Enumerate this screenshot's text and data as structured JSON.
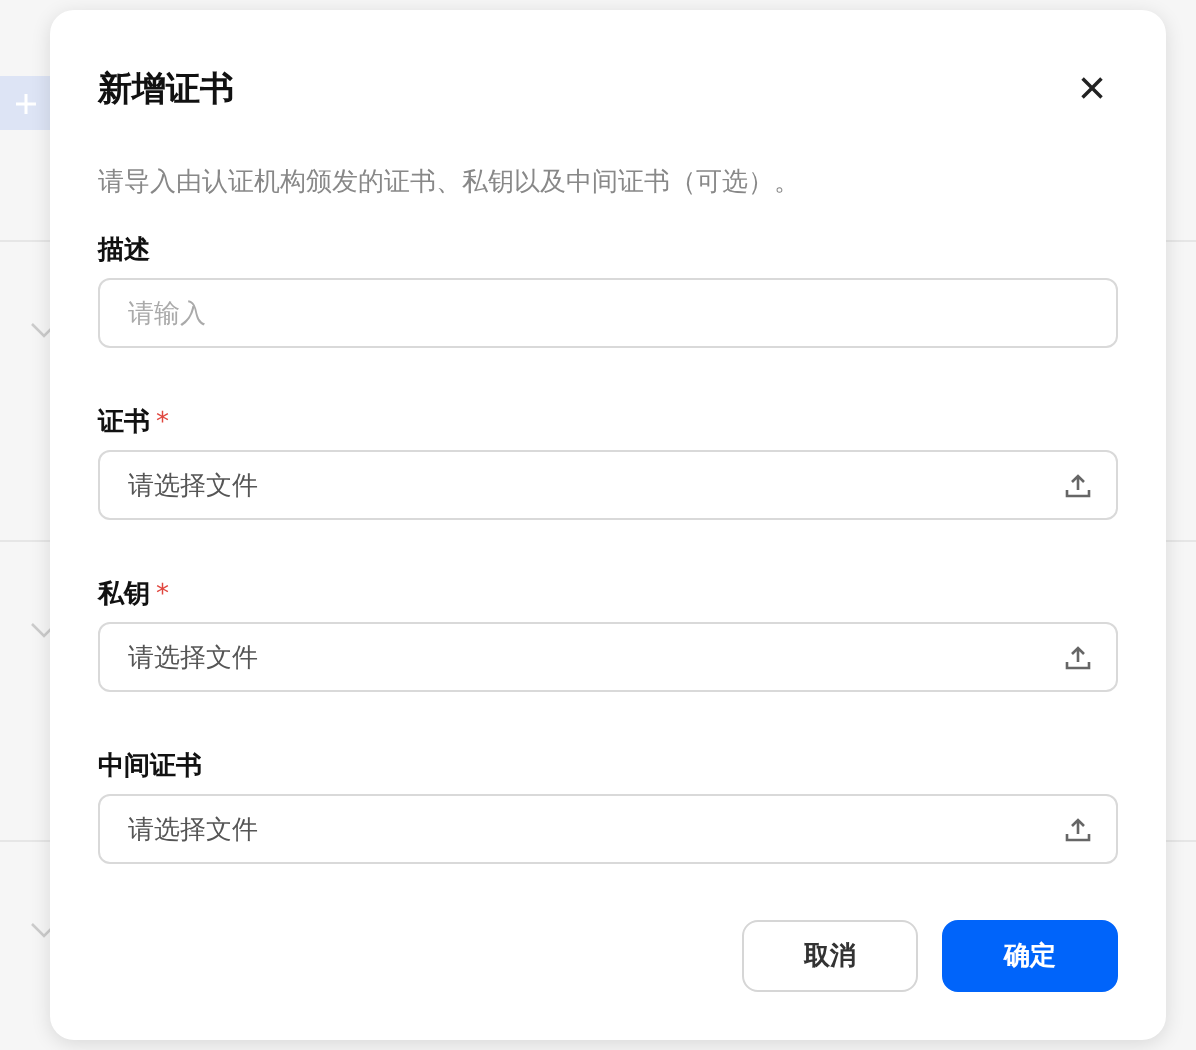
{
  "dialog": {
    "title": "新增证书",
    "close": "×",
    "description": "请导入由认证机构颁发的证书、私钥以及中间证书（可选）。",
    "fields": [
      {
        "kind": "text",
        "label": "描述",
        "placeholder": "请输入"
      },
      {
        "kind": "file",
        "label": "证书",
        "mark": "*",
        "placeholder": "请选择文件"
      },
      {
        "kind": "file",
        "label": "私钥",
        "mark": "*",
        "placeholder": "请选择文件"
      },
      {
        "kind": "file",
        "label": "中间证书",
        "placeholder": "请选择文件"
      }
    ],
    "buttons": [
      {
        "label": "取消",
        "kind": "secondary"
      },
      {
        "label": "确定",
        "kind": "primary"
      }
    ]
  }
}
